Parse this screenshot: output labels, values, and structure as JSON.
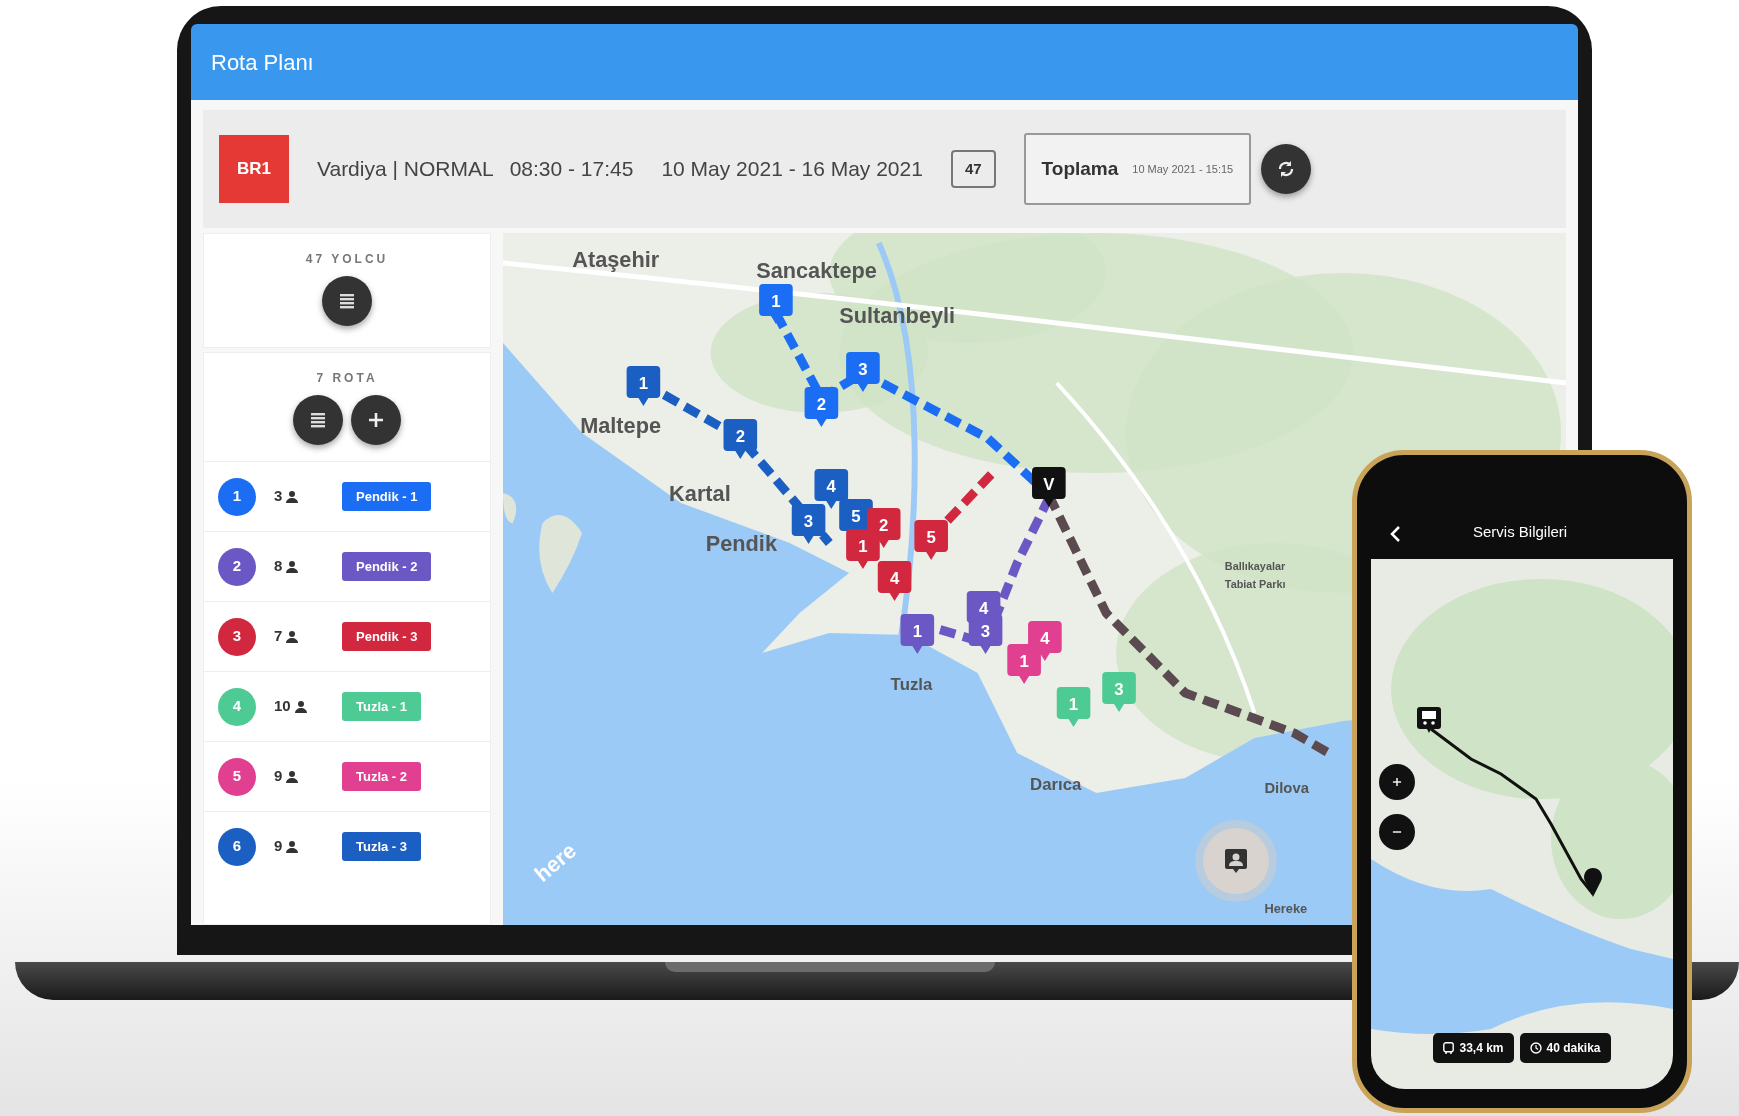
{
  "app_bar": {
    "title": "Rota Planı"
  },
  "header": {
    "code": "BR1",
    "shift": "Vardiya | NORMAL",
    "hours": "08:30 - 17:45",
    "date_range": "10 May 2021 - 16 May 2021",
    "count": "47",
    "mode": {
      "label": "Toplama",
      "timestamp": "10 May 2021 - 15:15"
    }
  },
  "sidebar": {
    "passengers": {
      "title": "47 YOLCU"
    },
    "routes": {
      "title": "7 ROTA",
      "items": [
        {
          "number": "1",
          "passengers": "3",
          "label": "Pendik - 1",
          "color": "#1b6ef3"
        },
        {
          "number": "2",
          "passengers": "8",
          "label": "Pendik - 2",
          "color": "#6c58c4"
        },
        {
          "number": "3",
          "passengers": "7",
          "label": "Pendik - 3",
          "color": "#d2283f"
        },
        {
          "number": "4",
          "passengers": "10",
          "label": "Tuzla - 1",
          "color": "#4ecb94"
        },
        {
          "number": "5",
          "passengers": "9",
          "label": "Tuzla - 2",
          "color": "#e0408f"
        },
        {
          "number": "6",
          "passengers": "9",
          "label": "Tuzla - 3",
          "color": "#1c5fc2"
        }
      ]
    }
  },
  "map": {
    "place_labels": [
      "Ataşehir",
      "Sancaktepe",
      "Sultanbeyli",
      "Maltepe",
      "Kartal",
      "Pendik",
      "Tuzla",
      "Darıca",
      "Ballıkayalar",
      "Tabiat Parkı",
      "Dilova",
      "Hereke"
    ],
    "route_lines": [
      {
        "color": "#1b6ef3"
      },
      {
        "color": "#1c5fc2"
      },
      {
        "color": "#d2283f"
      },
      {
        "color": "#6c58c4"
      },
      {
        "color": "#5b4a50"
      }
    ],
    "markers": [
      {
        "label": "1",
        "color": "#1b6ef3"
      },
      {
        "label": "2",
        "color": "#1b6ef3"
      },
      {
        "label": "3",
        "color": "#1b6ef3"
      },
      {
        "label": "1",
        "color": "#1c5fc2"
      },
      {
        "label": "2",
        "color": "#1c5fc2"
      },
      {
        "label": "4",
        "color": "#1c5fc2"
      },
      {
        "label": "3",
        "color": "#1c5fc2"
      },
      {
        "label": "5",
        "color": "#1c5fc2"
      },
      {
        "label": "1",
        "color": "#d2283f"
      },
      {
        "label": "2",
        "color": "#d2283f"
      },
      {
        "label": "5",
        "color": "#d2283f"
      },
      {
        "label": "4",
        "color": "#d2283f"
      },
      {
        "label": "1",
        "color": "#6c58c4"
      },
      {
        "label": "4",
        "color": "#6c58c4"
      },
      {
        "label": "3",
        "color": "#6c58c4"
      },
      {
        "label": "1",
        "color": "#e0408f"
      },
      {
        "label": "4",
        "color": "#e0408f"
      },
      {
        "label": "1",
        "color": "#4ecb94"
      },
      {
        "label": "3",
        "color": "#4ecb94"
      },
      {
        "label": "V",
        "color": "#111111"
      }
    ],
    "attribution": "here"
  },
  "phone": {
    "title": "Servis Bilgileri",
    "distance": "33,4 km",
    "duration": "40 dakika"
  }
}
